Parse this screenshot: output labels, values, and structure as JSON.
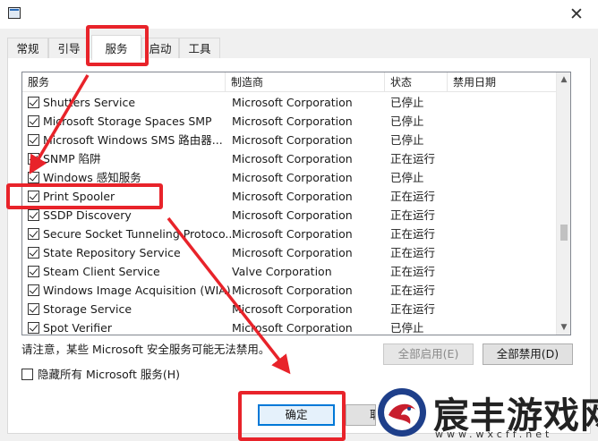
{
  "window": {
    "close_glyph": "✕"
  },
  "tabs": [
    {
      "label": "常规",
      "active": false
    },
    {
      "label": "引导",
      "active": false
    },
    {
      "label": "服务",
      "active": true
    },
    {
      "label": "启动",
      "active": false
    },
    {
      "label": "工具",
      "active": false
    }
  ],
  "table": {
    "columns": [
      "服务",
      "制造商",
      "状态",
      "禁用日期"
    ],
    "rows": [
      {
        "name": "Shutters Service",
        "manufacturer": "Microsoft Corporation",
        "status": "已停止",
        "checked": true
      },
      {
        "name": "Microsoft Storage Spaces SMP",
        "manufacturer": "Microsoft Corporation",
        "status": "已停止",
        "checked": true
      },
      {
        "name": "Microsoft Windows SMS 路由器...",
        "manufacturer": "Microsoft Corporation",
        "status": "已停止",
        "checked": true
      },
      {
        "name": "SNMP 陷阱",
        "manufacturer": "Microsoft Corporation",
        "status": "正在运行",
        "checked": true
      },
      {
        "name": "Windows 感知服务",
        "manufacturer": "Microsoft Corporation",
        "status": "已停止",
        "checked": true
      },
      {
        "name": "Print Spooler",
        "manufacturer": "Microsoft Corporation",
        "status": "正在运行",
        "checked": true
      },
      {
        "name": "SSDP Discovery",
        "manufacturer": "Microsoft Corporation",
        "status": "正在运行",
        "checked": true
      },
      {
        "name": "Secure Socket Tunneling Protoco...",
        "manufacturer": "Microsoft Corporation",
        "status": "正在运行",
        "checked": true
      },
      {
        "name": "State Repository Service",
        "manufacturer": "Microsoft Corporation",
        "status": "正在运行",
        "checked": true
      },
      {
        "name": "Steam Client Service",
        "manufacturer": "Valve Corporation",
        "status": "正在运行",
        "checked": true
      },
      {
        "name": "Windows Image Acquisition (WIA)",
        "manufacturer": "Microsoft Corporation",
        "status": "正在运行",
        "checked": true
      },
      {
        "name": "Storage Service",
        "manufacturer": "Microsoft Corporation",
        "status": "正在运行",
        "checked": true
      },
      {
        "name": "Spot Verifier",
        "manufacturer": "Microsoft Corporation",
        "status": "已停止",
        "checked": true
      }
    ]
  },
  "scroll": {
    "up_glyph": "▲",
    "down_glyph": "▼"
  },
  "note": "请注意，某些 Microsoft 安全服务可能无法禁用。",
  "buttons": {
    "enable_all": "全部启用(E)",
    "disable_all": "全部禁用(D)",
    "ok": "确定",
    "cancel_partial": "取"
  },
  "hide_ms_services": {
    "label": "隐藏所有 Microsoft 服务(H)",
    "checked": false
  },
  "watermark_logo": {
    "main": "宸丰游戏网",
    "sub": "www.wxcff.net"
  },
  "colors": {
    "highlight": "#e8232a",
    "accent": "#0078d7"
  }
}
